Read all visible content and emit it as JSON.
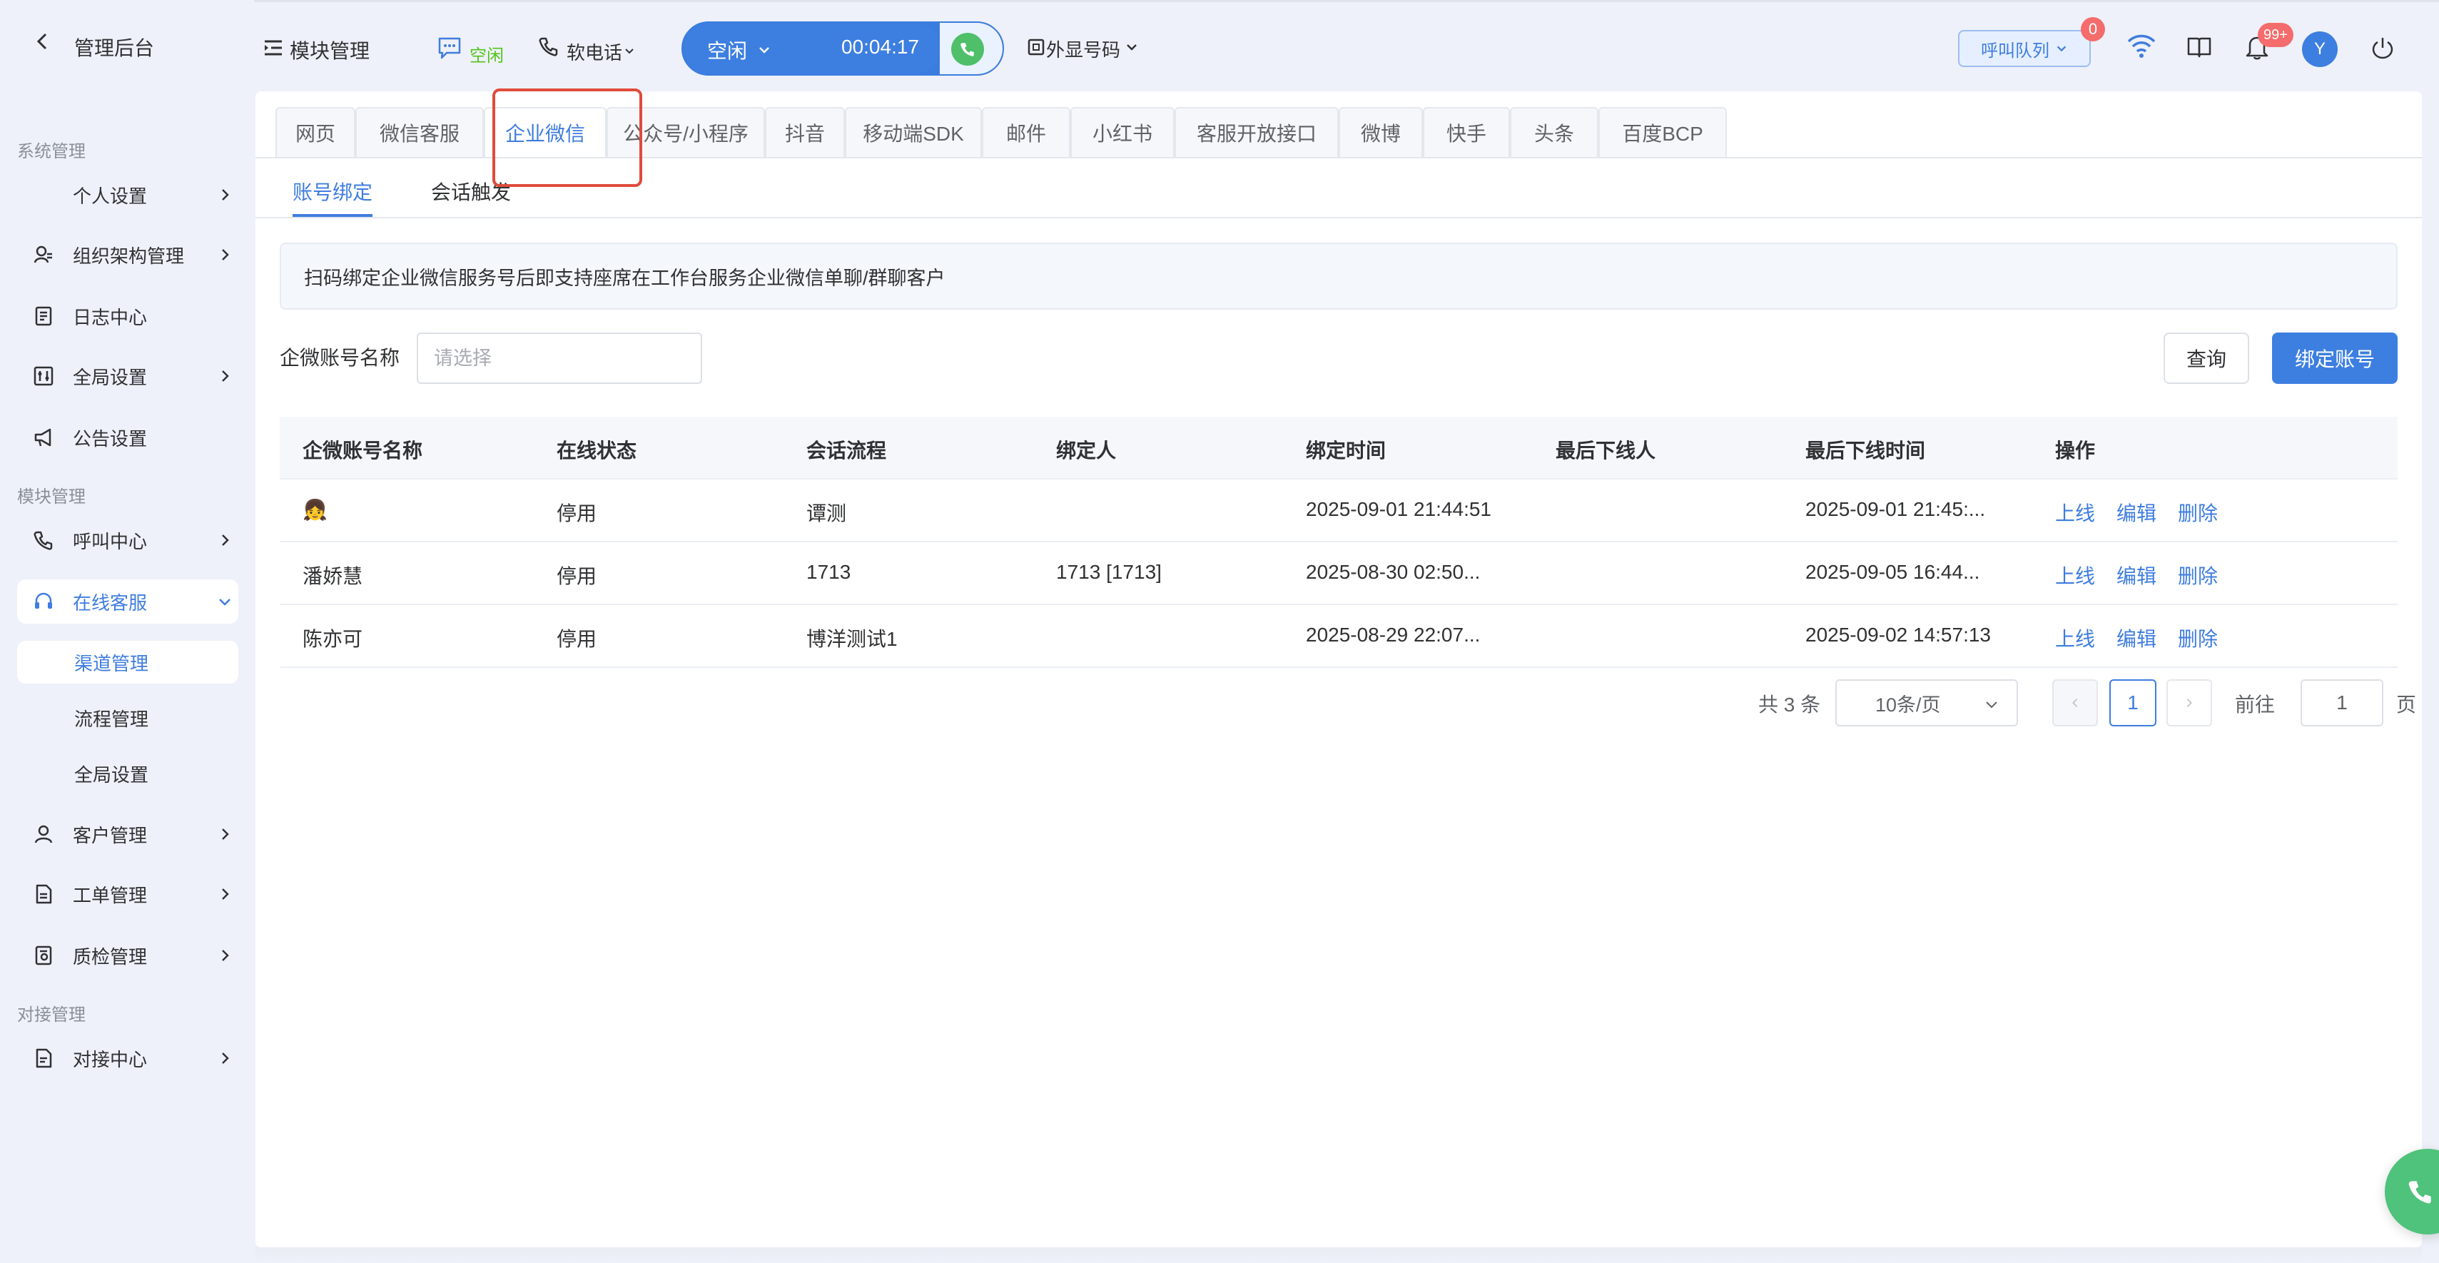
{
  "sidebar": {
    "title": "管理后台",
    "group_system": "系统管理",
    "group_module": "模块管理",
    "group_integration": "对接管理",
    "items": {
      "personal": "个人设置",
      "org": "组织架构管理",
      "log": "日志中心",
      "global": "全局设置",
      "notice": "公告设置",
      "callcenter": "呼叫中心",
      "online": "在线客服",
      "channel": "渠道管理",
      "flow": "流程管理",
      "global_sub": "全局设置",
      "customer": "客户管理",
      "ticket": "工单管理",
      "qc": "质检管理",
      "integration": "对接中心"
    }
  },
  "topbar": {
    "module_mgmt": "模块管理",
    "chat_status": "空闲",
    "softphone": "软电话",
    "agent_status": "空闲",
    "timer": "00:04:17",
    "caller_id": "外显号码",
    "queue": "呼叫队列",
    "queue_badge": "0",
    "notify_badge": "99+",
    "avatar_letter": "Y"
  },
  "tabs": [
    "网页",
    "微信客服",
    "企业微信",
    "公众号/小程序",
    "抖音",
    "移动端SDK",
    "邮件",
    "小红书",
    "客服开放接口",
    "微博",
    "快手",
    "头条",
    "百度BCP"
  ],
  "active_tab": "企业微信",
  "subtabs": [
    "账号绑定",
    "会话触发"
  ],
  "notice": "扫码绑定企业微信服务号后即支持座席在工作台服务企业微信单聊/群聊客户",
  "filter": {
    "label": "企微账号名称",
    "placeholder": "请选择",
    "query_btn": "查询",
    "bind_btn": "绑定账号"
  },
  "table": {
    "columns": [
      "企微账号名称",
      "在线状态",
      "会话流程",
      "绑定人",
      "绑定时间",
      "最后下线人",
      "最后下线时间",
      "操作"
    ],
    "rows": [
      {
        "name": "👧",
        "status": "停用",
        "flow": "谭测",
        "binder": "",
        "bind_time": "2025-09-01 21:44:51",
        "last_off_by": "",
        "last_off_time": "2025-09-01 21:45:...",
        "op_online": "上线",
        "op_edit": "编辑",
        "op_delete": "删除"
      },
      {
        "name": "潘娇慧",
        "status": "停用",
        "flow": "1713",
        "binder": "1713 [1713]",
        "bind_time": "2025-08-30 02:50...",
        "last_off_by": "",
        "last_off_time": "2025-09-05 16:44...",
        "op_online": "上线",
        "op_edit": "编辑",
        "op_delete": "删除"
      },
      {
        "name": "陈亦可",
        "status": "停用",
        "flow": "博洋测试1",
        "binder": "",
        "bind_time": "2025-08-29 22:07...",
        "last_off_by": "",
        "last_off_time": "2025-09-02 14:57:13",
        "op_online": "上线",
        "op_edit": "编辑",
        "op_delete": "删除"
      }
    ]
  },
  "pagination": {
    "total": "共 3 条",
    "page_size": "10条/页",
    "current": "1",
    "goto_label": "前往",
    "goto_value": "1",
    "page_suffix": "页"
  },
  "colors": {
    "accent": "#3f7ddf",
    "highlight_box": "#e04b3c",
    "call_green": "#4fc27b"
  }
}
